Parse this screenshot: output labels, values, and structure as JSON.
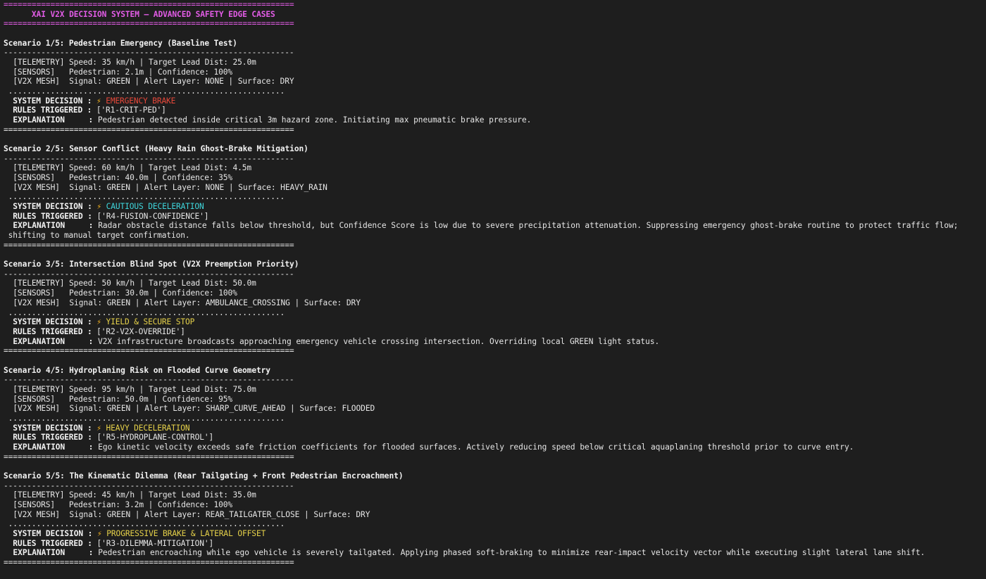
{
  "header": {
    "rule_double": "==============================================================",
    "title": "XAI V2X DECISION SYSTEM — ADVANCED SAFETY EDGE CASES"
  },
  "rules": {
    "single": "--------------------------------------------------------------",
    "double": "==============================================================",
    "dotted": "..........................................................."
  },
  "labels": {
    "telemetry": "[TELEMETRY]",
    "sensors": "[SENSORS]",
    "v2x_mesh": "[V2X MESH]",
    "system_decision": "SYSTEM DECISION :",
    "rules_triggered": "RULES TRIGGERED :",
    "explanation": "EXPLANATION     :"
  },
  "icons": {
    "decision": "lightning-bolt-icon",
    "bolt_glyph": "⚡"
  },
  "colors": {
    "background": "#1e1e1e",
    "header_magenta": "#e25ce6",
    "emergency_red": "#e8483a",
    "cautious_cyan": "#3fd7dd",
    "warning_yellow": "#e6d24a"
  },
  "scenarios": [
    {
      "title": "Scenario 1/5: Pedestrian Emergency (Baseline Test)",
      "telemetry": "Speed: 35 km/h | Target Lead Dist: 25.0m",
      "sensors": "Pedestrian: 2.1m | Confidence: 100%",
      "v2x": "Signal: GREEN | Alert Layer: NONE | Surface: DRY",
      "decision": "EMERGENCY BRAKE",
      "rules": "['R1-CRIT-PED']",
      "explanation_1": "Pedestrian detected inside critical 3m hazard zone. Initiating max pneumatic brake pressure.",
      "explanation_2": ""
    },
    {
      "title": "Scenario 2/5: Sensor Conflict (Heavy Rain Ghost-Brake Mitigation)",
      "telemetry": "Speed: 60 km/h | Target Lead Dist: 4.5m",
      "sensors": "Pedestrian: 40.0m | Confidence: 35%",
      "v2x": "Signal: GREEN | Alert Layer: NONE | Surface: HEAVY_RAIN",
      "decision": "CAUTIOUS DECELERATION",
      "rules": "['R4-FUSION-CONFIDENCE']",
      "explanation_1": "Radar obstacle distance falls below threshold, but Confidence Score is low due to severe precipitation attenuation. Suppressing emergency ghost-brake routine to protect traffic flow;",
      "explanation_2": "shifting to manual target confirmation."
    },
    {
      "title": "Scenario 3/5: Intersection Blind Spot (V2X Preemption Priority)",
      "telemetry": "Speed: 50 km/h | Target Lead Dist: 50.0m",
      "sensors": "Pedestrian: 30.0m | Confidence: 100%",
      "v2x": "Signal: GREEN | Alert Layer: AMBULANCE_CROSSING | Surface: DRY",
      "decision": "YIELD & SECURE STOP",
      "rules": "['R2-V2X-OVERRIDE']",
      "explanation_1": "V2X infrastructure broadcasts approaching emergency vehicle crossing intersection. Overriding local GREEN light status.",
      "explanation_2": ""
    },
    {
      "title": "Scenario 4/5: Hydroplaning Risk on Flooded Curve Geometry",
      "telemetry": "Speed: 95 km/h | Target Lead Dist: 75.0m",
      "sensors": "Pedestrian: 50.0m | Confidence: 95%",
      "v2x": "Signal: GREEN | Alert Layer: SHARP_CURVE_AHEAD | Surface: FLOODED",
      "decision": "HEAVY DECELERATION",
      "rules": "['R5-HYDROPLANE-CONTROL']",
      "explanation_1": "Ego kinetic velocity exceeds safe friction coefficients for flooded surfaces. Actively reducing speed below critical aquaplaning threshold prior to curve entry.",
      "explanation_2": ""
    },
    {
      "title": "Scenario 5/5: The Kinematic Dilemma (Rear Tailgating + Front Pedestrian Encroachment)",
      "telemetry": "Speed: 45 km/h | Target Lead Dist: 35.0m",
      "sensors": "Pedestrian: 3.2m | Confidence: 100%",
      "v2x": "Signal: GREEN | Alert Layer: REAR_TAILGATER_CLOSE | Surface: DRY",
      "decision": "PROGRESSIVE BRAKE & LATERAL OFFSET",
      "rules": "['R3-DILEMMA-MITIGATION']",
      "explanation_1": "Pedestrian encroaching while ego vehicle is severely tailgated. Applying phased soft-braking to minimize rear-impact velocity vector while executing slight lateral lane shift.",
      "explanation_2": ""
    }
  ]
}
